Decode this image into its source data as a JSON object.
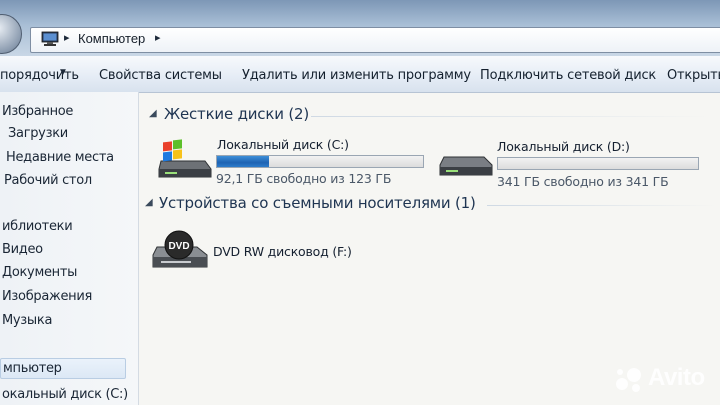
{
  "address_bar": {
    "breadcrumb": "Компьютер",
    "arrow1": "▸",
    "arrow2": "▸"
  },
  "toolbar": {
    "organize": "порядочить",
    "system_properties": "Свойства системы",
    "uninstall": "Удалить или изменить программу",
    "map_drive": "Подключить сетевой диск",
    "open_panel": "Открыть"
  },
  "sidebar": {
    "items": [
      {
        "label": "Избранное",
        "icon": "star-icon"
      },
      {
        "label": "Загрузки",
        "icon": "downloads-icon"
      },
      {
        "label": "Недавние места",
        "icon": "recent-places-icon"
      },
      {
        "label": "Рабочий стол",
        "icon": "desktop-icon"
      },
      {
        "label": "иблиотеки",
        "icon": "library-icon"
      },
      {
        "label": "Видео",
        "icon": "video-icon"
      },
      {
        "label": "Документы",
        "icon": "documents-icon"
      },
      {
        "label": "Изображения",
        "icon": "pictures-icon"
      },
      {
        "label": "Музыка",
        "icon": "music-icon"
      },
      {
        "label": "мпьютер",
        "icon": "computer-icon"
      },
      {
        "label": "окальный диск (C:)",
        "icon": "drive-icon"
      }
    ]
  },
  "groups": {
    "hard_drives": {
      "title": "Жесткие диски (2)",
      "drives": [
        {
          "name": "Локальный диск (C:)",
          "free": "92,1 ГБ свободно из 123 ГБ",
          "used_fraction": 0.25,
          "icon": "windows-system-drive-icon"
        },
        {
          "name": "Локальный диск (D:)",
          "free": "341 ГБ свободно из 341 ГБ",
          "used_fraction": 0.0,
          "icon": "hard-drive-icon"
        }
      ]
    },
    "removable": {
      "title": "Устройства со съемными носителями (1)",
      "drives": [
        {
          "name": "DVD RW дисковод (F:)",
          "icon": "dvd-drive-icon",
          "badge": "DVD"
        }
      ]
    }
  },
  "watermark": {
    "text": "Avito"
  },
  "colors": {
    "bar_fill": "#1e63b3",
    "group_title": "#1f3552"
  }
}
